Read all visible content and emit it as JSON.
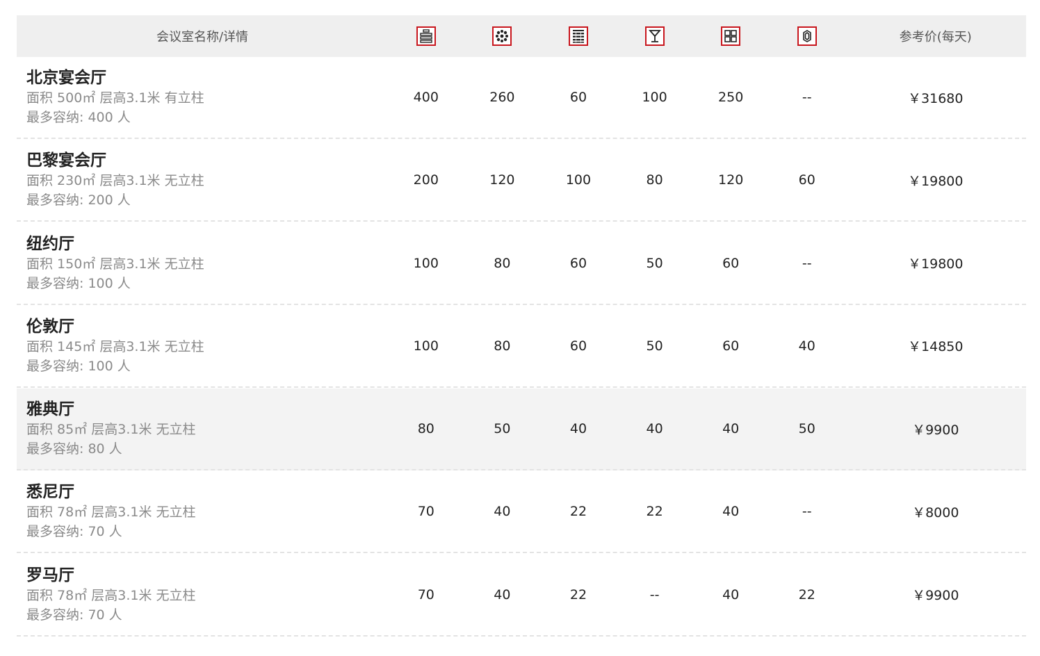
{
  "header": {
    "name_label": "会议室名称/详情",
    "price_label": "参考价(每天)",
    "layout_icons": [
      "theater-layout-icon",
      "banquet-layout-icon",
      "classroom-layout-icon",
      "cocktail-layout-icon",
      "board-layout-icon",
      "u-shape-layout-icon"
    ]
  },
  "accent_color": "#c8161d",
  "rooms": [
    {
      "name": "北京宴会厅",
      "detail": "面积 500㎡ 层高3.1米 有立柱",
      "capacity": "最多容纳: 400 人",
      "values": [
        "400",
        "260",
        "60",
        "100",
        "250",
        "--"
      ],
      "price": "￥31680"
    },
    {
      "name": "巴黎宴会厅",
      "detail": "面积 230㎡ 层高3.1米 无立柱",
      "capacity": "最多容纳: 200 人",
      "values": [
        "200",
        "120",
        "100",
        "80",
        "120",
        "60"
      ],
      "price": "￥19800"
    },
    {
      "name": "纽约厅",
      "detail": "面积 150㎡ 层高3.1米 无立柱",
      "capacity": "最多容纳: 100 人",
      "values": [
        "100",
        "80",
        "60",
        "50",
        "60",
        "--"
      ],
      "price": "￥19800"
    },
    {
      "name": "伦敦厅",
      "detail": "面积 145㎡ 层高3.1米 无立柱",
      "capacity": "最多容纳: 100 人",
      "values": [
        "100",
        "80",
        "60",
        "50",
        "60",
        "40"
      ],
      "price": "￥14850"
    },
    {
      "name": "雅典厅",
      "detail": "面积 85㎡ 层高3.1米 无立柱",
      "capacity": "最多容纳: 80 人",
      "values": [
        "80",
        "50",
        "40",
        "40",
        "40",
        "50"
      ],
      "price": "￥9900"
    },
    {
      "name": "悉尼厅",
      "detail": "面积 78㎡ 层高3.1米 无立柱",
      "capacity": "最多容纳: 70 人",
      "values": [
        "70",
        "40",
        "22",
        "22",
        "40",
        "--"
      ],
      "price": "￥8000"
    },
    {
      "name": "罗马厅",
      "detail": "面积 78㎡ 层高3.1米 无立柱",
      "capacity": "最多容纳: 70 人",
      "values": [
        "70",
        "40",
        "22",
        "--",
        "40",
        "22"
      ],
      "price": "￥9900"
    }
  ]
}
